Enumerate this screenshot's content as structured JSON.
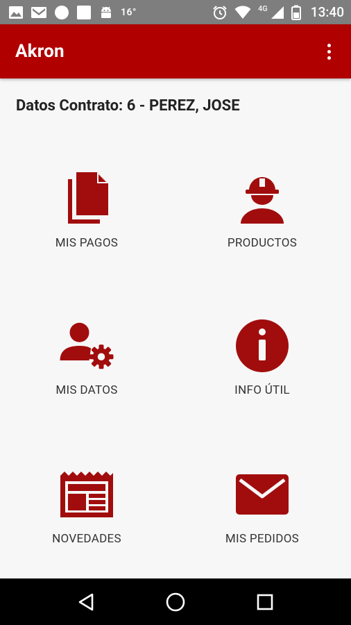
{
  "status_bar": {
    "temperature": "16°",
    "network": "4G",
    "time": "13:40"
  },
  "app_bar": {
    "title": "Akron"
  },
  "contract": {
    "heading": "Datos Contrato: 6 - PEREZ, JOSE"
  },
  "menu": [
    {
      "label": "MIS PAGOS",
      "icon": "documents-icon"
    },
    {
      "label": "PRODUCTOS",
      "icon": "worker-helmet-icon"
    },
    {
      "label": "MIS DATOS",
      "icon": "user-settings-icon"
    },
    {
      "label": "INFO ÚTIL",
      "icon": "info-icon"
    },
    {
      "label": "NOVEDADES",
      "icon": "newspaper-icon"
    },
    {
      "label": "MIS PEDIDOS",
      "icon": "envelope-icon"
    }
  ],
  "colors": {
    "primary": "#b00000",
    "icon": "#a10d0d",
    "status_bar": "#7e7e7e",
    "background": "#f7f7f7"
  }
}
